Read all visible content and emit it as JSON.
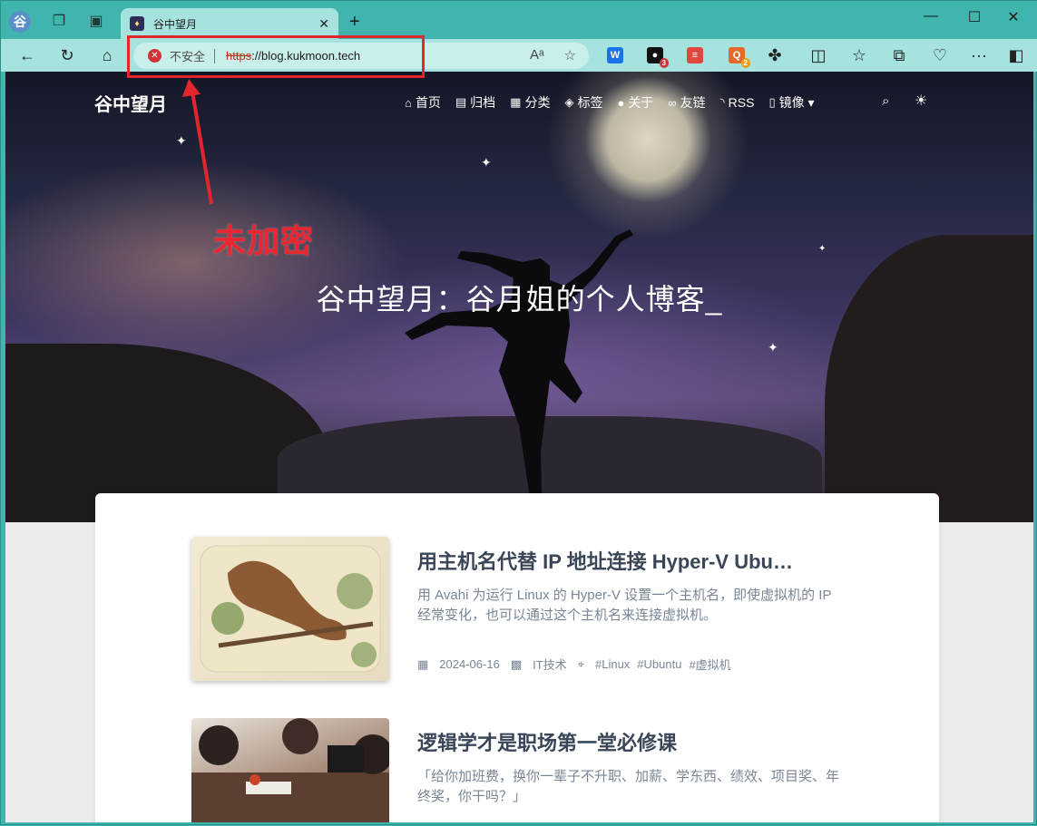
{
  "browser": {
    "profile_initial": "谷",
    "tab": {
      "title": "谷中望月"
    },
    "address": {
      "security_text": "不安全",
      "scheme": "https",
      "host": "://blog.kukmoon.tech"
    },
    "extensions": [
      {
        "name": "word-extension-icon",
        "color": "#1a73e8",
        "label": "W"
      },
      {
        "name": "tampermonkey-extension-icon",
        "color": "#111111",
        "label": "●",
        "badge": "3"
      },
      {
        "name": "notes-extension-icon",
        "color": "#e0483e",
        "label": "≡"
      },
      {
        "name": "search-extension-icon",
        "color": "#e46a2b",
        "label": "Q",
        "badge": "2"
      }
    ]
  },
  "annotation": {
    "label": "未加密",
    "color": "#e2262e"
  },
  "site": {
    "brand": "谷中望月",
    "nav": [
      {
        "icon": "home-icon",
        "glyph": "⌂",
        "label": "首页"
      },
      {
        "icon": "archive-icon",
        "glyph": "▤",
        "label": "归档"
      },
      {
        "icon": "category-icon",
        "glyph": "▦",
        "label": "分类"
      },
      {
        "icon": "tag-icon",
        "glyph": "◈",
        "label": "标签"
      },
      {
        "icon": "user-icon",
        "glyph": "●",
        "label": "关于"
      },
      {
        "icon": "link-icon",
        "glyph": "∞",
        "label": "友链"
      },
      {
        "icon": "rss-icon",
        "glyph": "◝",
        "label": "RSS"
      },
      {
        "icon": "mirror-icon",
        "glyph": "▯",
        "label": "镜像 ▾"
      }
    ],
    "hero_title": "谷中望月：谷月姐的个人博客_",
    "posts": [
      {
        "title": "用主机名代替 IP 地址连接 Hyper-V Ubu…",
        "excerpt": "用 Avahi 为运行 Linux 的 Hyper-V 设置一个主机名，即使虚拟机的 IP 经常变化，也可以通过这个主机名来连接虚拟机。",
        "date": "2024-06-16",
        "category": "IT技术",
        "tags": [
          "#Linux",
          "#Ubuntu",
          "#虚拟机"
        ]
      },
      {
        "title": "逻辑学才是职场第一堂必修课",
        "excerpt": "「给你加班费，换你一辈子不升职、加薪、学东西、绩效、项目奖、年终奖，你干吗？」"
      }
    ]
  }
}
